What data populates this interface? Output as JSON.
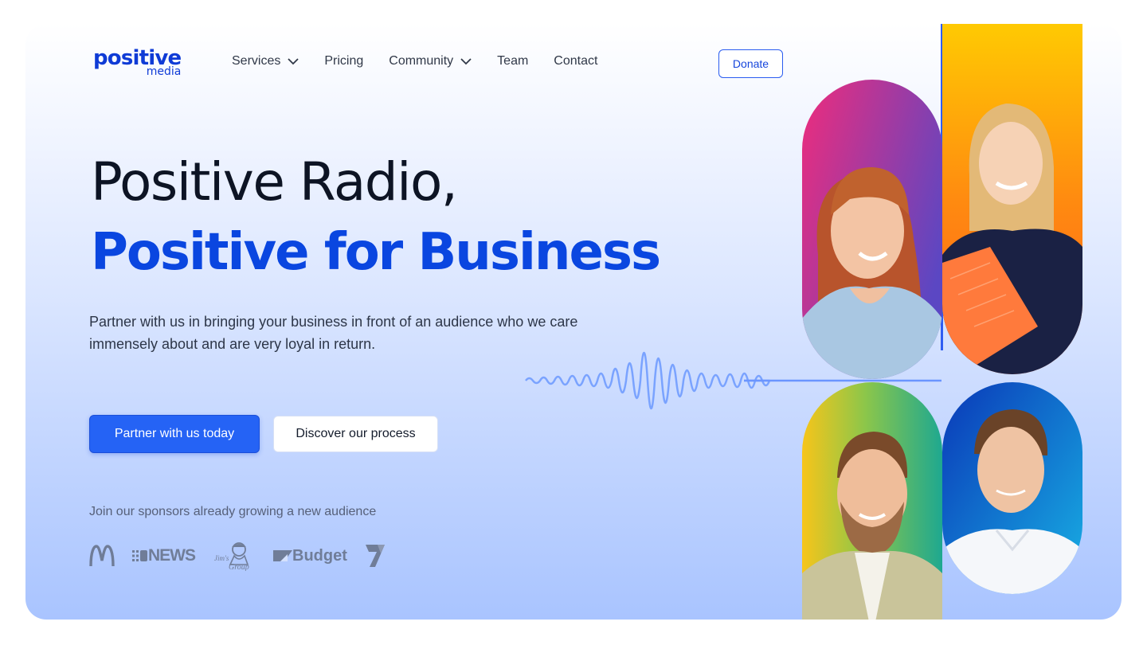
{
  "brand": {
    "name": "positive",
    "sub": "media"
  },
  "nav": {
    "items": [
      {
        "label": "Services",
        "dropdown": true
      },
      {
        "label": "Pricing",
        "dropdown": false
      },
      {
        "label": "Community",
        "dropdown": true
      },
      {
        "label": "Team",
        "dropdown": false
      },
      {
        "label": "Contact",
        "dropdown": false
      }
    ],
    "donate_label": "Donate"
  },
  "hero": {
    "title_line1": "Positive Radio,",
    "title_line2": "Positive for Business",
    "subtitle": "Partner with us in bringing your business in front of an audience who we care immensely about and are very loyal in return.",
    "primary_cta": "Partner with us today",
    "secondary_cta": "Discover our process"
  },
  "sponsors": {
    "heading": "Join our sponsors already growing a new audience",
    "logos": [
      {
        "name": "mcdonalds-logo"
      },
      {
        "name": "9news-logo",
        "text": "NEWS"
      },
      {
        "name": "jims-group-logo",
        "text": "Jim's Group"
      },
      {
        "name": "budget-logo",
        "text": "Budget"
      },
      {
        "name": "seven-logo"
      }
    ]
  },
  "colors": {
    "brand_blue": "#0a46e0",
    "primary_button": "#2563f5",
    "heading_dark": "#0d1424",
    "wave": "#7aa3ff"
  },
  "photos": [
    {
      "name": "photo-woman-red-hair",
      "gradient": [
        "#e8327f",
        "#6a4bc4"
      ]
    },
    {
      "name": "photo-woman-blonde-folder",
      "gradient": [
        "#ffd200",
        "#ff7a1a"
      ]
    },
    {
      "name": "photo-man-beard",
      "gradient": [
        "#f4c21a",
        "#2bb37a"
      ]
    },
    {
      "name": "photo-man-polo",
      "gradient": [
        "#0a3fbf",
        "#17a7e0"
      ]
    }
  ]
}
